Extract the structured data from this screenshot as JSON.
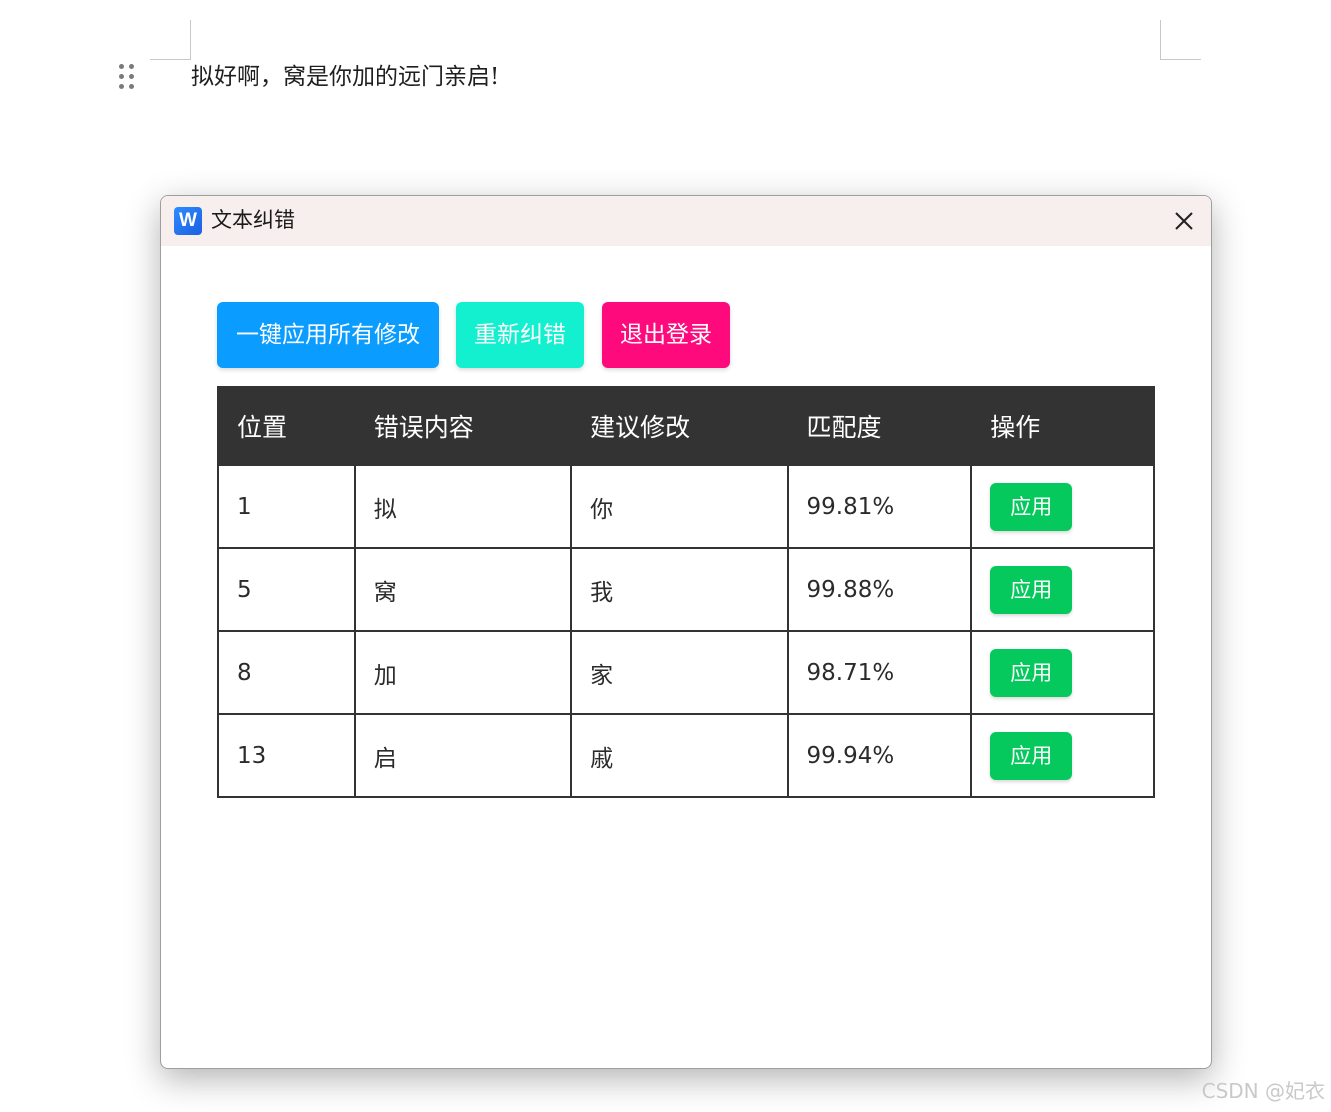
{
  "document": {
    "text": "拟好啊，窝是你加的远门亲启!"
  },
  "dialog": {
    "title": "文本纠错",
    "app_icon_letter": "W",
    "close_icon": "close-icon"
  },
  "toolbar": {
    "apply_all_label": "一键应用所有修改",
    "recheck_label": "重新纠错",
    "logout_label": "退出登录"
  },
  "table": {
    "headers": [
      "位置",
      "错误内容",
      "建议修改",
      "匹配度",
      "操作"
    ],
    "rows": [
      {
        "position": "1",
        "error": "拟",
        "suggestion": "你",
        "match": "99.81%",
        "action": "应用"
      },
      {
        "position": "5",
        "error": "窝",
        "suggestion": "我",
        "match": "99.88%",
        "action": "应用"
      },
      {
        "position": "8",
        "error": "加",
        "suggestion": "家",
        "match": "98.71%",
        "action": "应用"
      },
      {
        "position": "13",
        "error": "启",
        "suggestion": "戚",
        "match": "99.94%",
        "action": "应用"
      }
    ]
  },
  "watermark": "CSDN @妃衣",
  "colors": {
    "apply_all": "#0a9cff",
    "recheck": "#13f0cf",
    "logout": "#ff0a7c",
    "apply": "#05c95c",
    "table_header": "#333333",
    "titlebar": "#f7efee"
  }
}
